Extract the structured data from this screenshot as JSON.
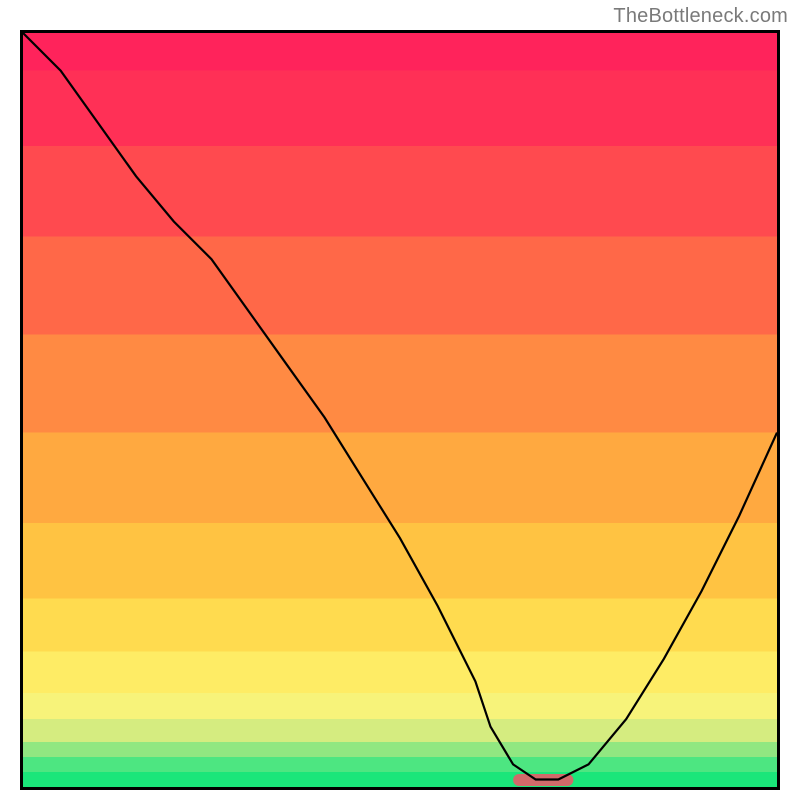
{
  "watermark": "TheBottleneck.com",
  "chart_data": {
    "type": "line",
    "title": "",
    "xlabel": "",
    "ylabel": "",
    "xlim": [
      0,
      100
    ],
    "ylim": [
      0,
      100
    ],
    "x": [
      0,
      5,
      10,
      15,
      20,
      25,
      30,
      35,
      40,
      45,
      50,
      55,
      60,
      62,
      65,
      68,
      71,
      75,
      80,
      85,
      90,
      95,
      100
    ],
    "values": [
      100,
      95,
      88,
      81,
      75,
      70,
      63,
      56,
      49,
      41,
      33,
      24,
      14,
      8,
      3,
      1,
      1,
      3,
      9,
      17,
      26,
      36,
      47
    ],
    "minimum_marker": {
      "x_start": 65,
      "x_end": 73,
      "color": "#d16a6a"
    },
    "gradient_bands": [
      {
        "y0": 0,
        "y1": 2,
        "color": "#1ae67a"
      },
      {
        "y0": 2,
        "y1": 4,
        "color": "#4de681"
      },
      {
        "y0": 4,
        "y1": 6,
        "color": "#91e781"
      },
      {
        "y0": 6,
        "y1": 9,
        "color": "#d5ec80"
      },
      {
        "y0": 9,
        "y1": 12.5,
        "color": "#f7f37a"
      },
      {
        "y0": 12.5,
        "y1": 18,
        "color": "#feec65"
      },
      {
        "y0": 18,
        "y1": 25,
        "color": "#ffdb4f"
      },
      {
        "y0": 25,
        "y1": 35,
        "color": "#ffc342"
      },
      {
        "y0": 35,
        "y1": 47,
        "color": "#ffa940"
      },
      {
        "y0": 47,
        "y1": 60,
        "color": "#ff8a43"
      },
      {
        "y0": 60,
        "y1": 73,
        "color": "#ff6848"
      },
      {
        "y0": 73,
        "y1": 85,
        "color": "#ff4a4f"
      },
      {
        "y0": 85,
        "y1": 95,
        "color": "#ff3056"
      },
      {
        "y0": 95,
        "y1": 100,
        "color": "#ff235b"
      }
    ]
  }
}
